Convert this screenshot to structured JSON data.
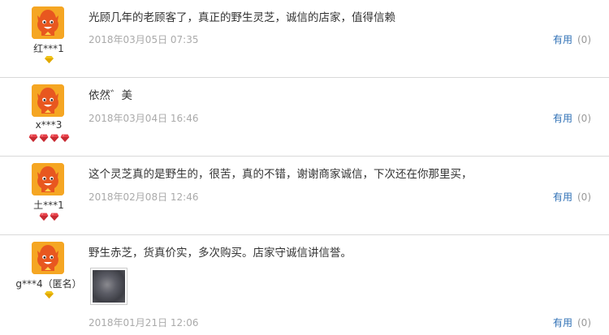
{
  "reviews": [
    {
      "username": "红***1",
      "badge_kind": "gold",
      "badge_count": 1,
      "content": "光顾几年的老顾客了，真正的野生灵芝，诚信的店家，值得信赖",
      "date": "2018年03月05日 07:35",
      "useful_label": "有用",
      "useful_count": "(0)"
    },
    {
      "username": "x***3",
      "badge_kind": "red",
      "badge_count": 4,
      "content": "依然゛美",
      "date": "2018年03月04日 16:46",
      "useful_label": "有用",
      "useful_count": "(0)"
    },
    {
      "username": "土***1",
      "badge_kind": "red",
      "badge_count": 2,
      "content": "这个灵芝真的是野生的，很苦，真的不错，谢谢商家诚信，下次还在你那里买，",
      "date": "2018年02月08日 12:46",
      "useful_label": "有用",
      "useful_count": "(0)"
    },
    {
      "username": "g***4（匿名）",
      "badge_kind": "gold",
      "badge_count": 1,
      "content": "野生赤芝，货真价实，多次购买。店家守诚信讲信誉。",
      "date": "2018年01月21日 12:06",
      "useful_label": "有用",
      "useful_count": "(0)",
      "has_photo": true
    }
  ],
  "colors": {
    "avatar_bg": "#f5a623",
    "link_blue": "#2e6fb5",
    "date_gray": "#aaaaaa",
    "gold_badge": "#f0c419",
    "red_badge": "#e8434b"
  },
  "icons": {
    "avatar": "orange-mascot-avatar-icon",
    "gold_badge": "gold-diamond-icon",
    "red_badge": "red-heart-diamond-icon"
  }
}
